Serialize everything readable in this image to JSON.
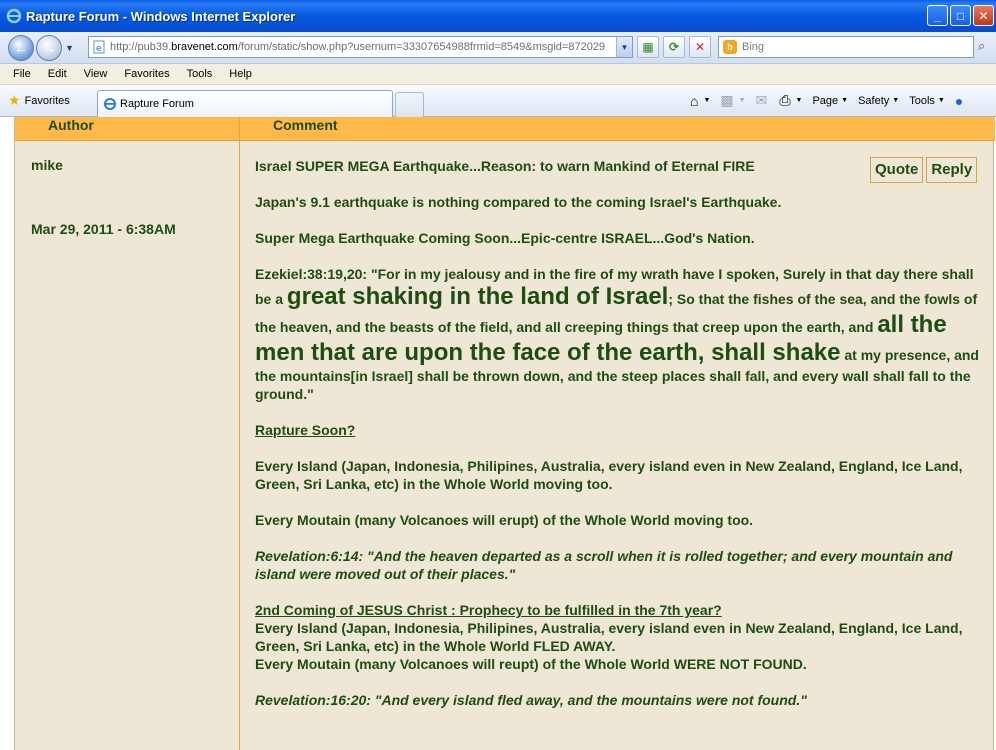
{
  "window": {
    "title": "Rapture Forum - Windows Internet Explorer",
    "icon": "ie-logo-icon",
    "controls": [
      "minimize-icon",
      "maximize-icon",
      "close-icon"
    ]
  },
  "address_bar": {
    "url_prefix": "http://pub39.",
    "url_host": "bravenet.com",
    "url_rest": "/forum/static/show.php?usernum=33307654988frmid=8549&msgid=872029",
    "search_placeholder": "Bing"
  },
  "menu": [
    "File",
    "Edit",
    "View",
    "Favorites",
    "Tools",
    "Help"
  ],
  "favorites_label": "Favorites",
  "tab_title": "Rapture Forum",
  "command_bar": {
    "page": "Page",
    "safety": "Safety",
    "tools": "Tools"
  },
  "forum": {
    "col_author": "Author",
    "col_comment": "Comment",
    "author": "mike",
    "date": "Mar 29, 2011 - 6:38AM",
    "quote_label": "Quote",
    "reply_label": "Reply",
    "subject": "Israel SUPER MEGA Earthquake...Reason: to warn Mankind of Eternal FIRE",
    "p1": "Japan's 9.1 earthquake is nothing compared to the coming Israel's Earthquake.",
    "p2": "Super Mega Earthquake Coming Soon...Epic-centre ISRAEL...God's Nation.",
    "p3_a": "Ezekiel:38:19,20: \"For in my jealousy and in the fire of my wrath have I spoken, Surely in that day there shall be a ",
    "p3_big1": "great shaking in the land of Israel",
    "p3_b": "; So that the fishes of the sea, and the fowls of the heaven, and the beasts of the field, and all creeping things that creep upon the earth, and ",
    "p3_big2": "all the men that are upon the face of the earth, shall shake",
    "p3_c": " at my presence, and the mountains[in Israel] shall be thrown down, and the steep places shall fall, and every wall shall fall to the ground.\"",
    "h1": "Rapture Soon?",
    "p4": "Every Island (Japan, Indonesia, Philipines, Australia, every island even in New Zealand, England, Ice Land, Green, Sri Lanka, etc) in the Whole World moving too.",
    "p5": "Every Moutain (many Volcanoes will erupt) of the Whole World moving too.",
    "p6": "Revelation:6:14: \"And the heaven departed as a scroll when it is rolled together; and every mountain and island were moved out of their places.\"",
    "h2": "2nd Coming of JESUS Christ : Prophecy to be fulfilled in the 7th year?",
    "p7": "Every Island (Japan, Indonesia, Philipines, Australia, every island even in New Zealand, England, Ice Land, Green, Sri Lanka, etc) in the Whole World FLED AWAY.",
    "p8": "Every Moutain (many Volcanoes will reupt) of the Whole World WERE NOT FOUND.",
    "p9": "Revelation:16:20: \"And every island fled away, and the mountains were not found.\""
  }
}
